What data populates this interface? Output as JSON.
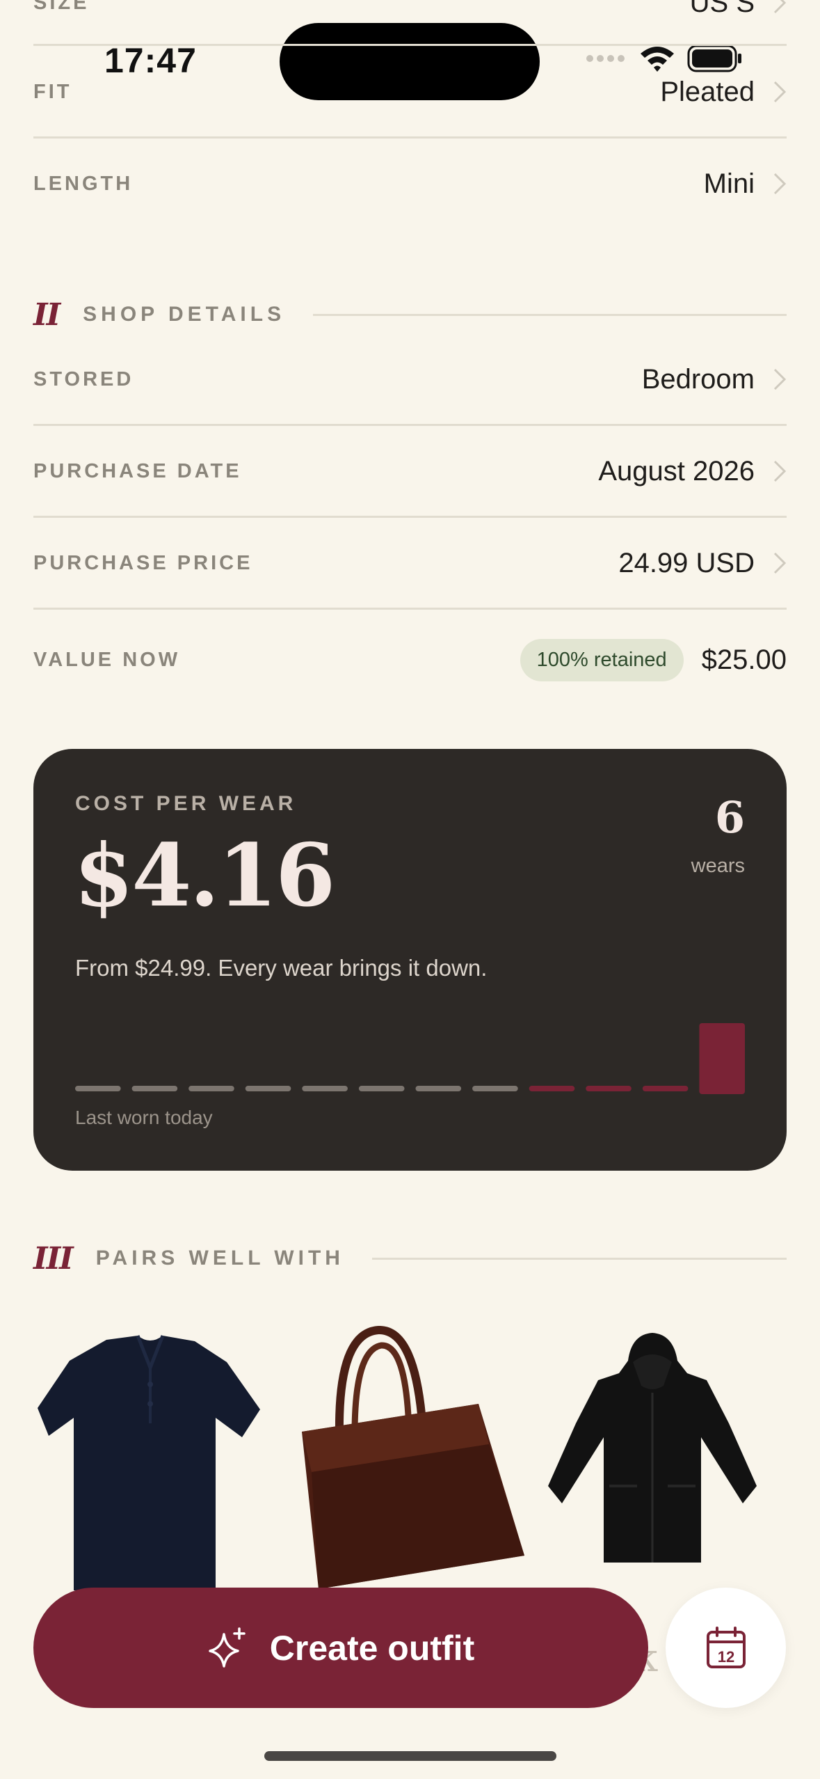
{
  "status_bar": {
    "time": "17:47"
  },
  "attributes": [
    {
      "label": "SIZE",
      "value": "US S"
    },
    {
      "label": "FIT",
      "value": "Pleated"
    },
    {
      "label": "LENGTH",
      "value": "Mini"
    }
  ],
  "shop_section": {
    "numeral": "II",
    "title": "SHOP DETAILS",
    "rows": [
      {
        "label": "STORED",
        "value": "Bedroom"
      },
      {
        "label": "PURCHASE DATE",
        "value": "August 2026"
      },
      {
        "label": "PURCHASE PRICE",
        "value": "24.99 USD"
      }
    ],
    "value_now": {
      "label": "VALUE NOW",
      "badge": "100% retained",
      "value": "$25.00"
    }
  },
  "cost_per_wear": {
    "label": "COST PER WEAR",
    "price": "$4.16",
    "wear_count": "6",
    "wear_unit": "wears",
    "description": "From $24.99. Every wear brings it down.",
    "last_worn": "Last worn today",
    "timeline": {
      "slots": 12,
      "worn_slots": [
        9,
        10,
        11,
        12
      ],
      "current_slot": 12,
      "colors": {
        "unworn": "#7c756f",
        "worn": "#7a2336",
        "card": "#2d2926"
      }
    }
  },
  "pairs_section": {
    "numeral": "III",
    "title": "PAIRS WELL WITH",
    "items": [
      {
        "name": "navy-polo-shirt"
      },
      {
        "name": "brown-leather-tote"
      },
      {
        "name": "black-hooded-coat"
      }
    ]
  },
  "actions": {
    "create_outfit": "Create outfit",
    "calendar_day": "12"
  },
  "colors": {
    "accent": "#7a2336",
    "background": "#f9f5eb",
    "muted": "#8a857b"
  }
}
